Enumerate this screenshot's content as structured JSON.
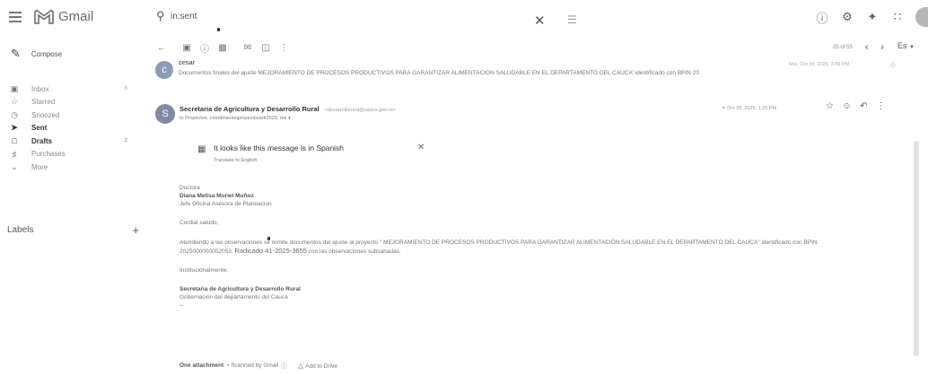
{
  "app": {
    "name": "Gmail"
  },
  "search": {
    "query": "in:sent"
  },
  "compose": {
    "label": "Compose"
  },
  "sidebar": {
    "items": [
      {
        "label": "Inbox",
        "count": "6"
      },
      {
        "label": "Starred",
        "count": ""
      },
      {
        "label": "Snoozed",
        "count": ""
      },
      {
        "label": "Sent",
        "count": ""
      },
      {
        "label": "Drafts",
        "count": "2"
      },
      {
        "label": "Purchases",
        "count": ""
      },
      {
        "label": "More",
        "count": ""
      }
    ],
    "labels_heading": "Labels"
  },
  "pager": {
    "text": "25 of 55"
  },
  "language": {
    "label": "Es"
  },
  "previous_message": {
    "avatar_letter": "c",
    "sender": "cesar",
    "snippet": "Documentos finales del ajuste MEJORAMIENTO DE PROCESOS PRODUCTIVOS PARA GARANTIZAR ALIMENTACIÓN SALUDABLE EN EL DEPARTAMENTO DEL CAUCA' identificado con BPIN 20",
    "date": "Mar, Oct 28, 2025, 3:55 PM"
  },
  "message": {
    "avatar_letter": "S",
    "sender": "Secretaria de Agricultura y Desarrollo Rural",
    "sender_email": "<desarrollorural@cauca.gov.co>",
    "recipients": "to Proyectos, coordinacionproyectosadr2023, me",
    "date": "Oct 28, 2025, 1:25 PM"
  },
  "translate": {
    "title": "It looks like this message is in Spanish",
    "link": "Translate to English"
  },
  "body": {
    "salutation": "Doctora",
    "recipient_name": "Diana Melisa Muriel Muñoz",
    "recipient_title": "Jefe Oficina Asesora de Planeacion",
    "greeting": "Cordial saludo,",
    "paragraph_part1": "Atendiendo a las observaciones se remite documentos del ajuste al proyecto \" MEJORAMIENTO DE PROCESOS PRODUCTIVOS PARA GARANTIZAR ALIMENTACIÓN SALUDABLE EN EL DEPARTAMENTO DEL CAUCA\" identificado con BPIN 2025000000052053.",
    "radicado": "Radicado 41-2025-3655",
    "paragraph_part2": "con las observaciones subsanadas.",
    "closing": "Institucionalmente,",
    "signature_name": "Secretaria de Agricultura y Desarrollo Rural",
    "signature_org": "Gobernación del departamento del Cauca",
    "signature_dash": "--"
  },
  "attachment": {
    "label": "One attachment",
    "scanned": "• Scanned by Gmail",
    "add_to_drive": "Add to Drive"
  },
  "colors": {
    "accent": "#3c4043",
    "avatar": "#7e8aa7",
    "gmail_red": "#d44638"
  }
}
